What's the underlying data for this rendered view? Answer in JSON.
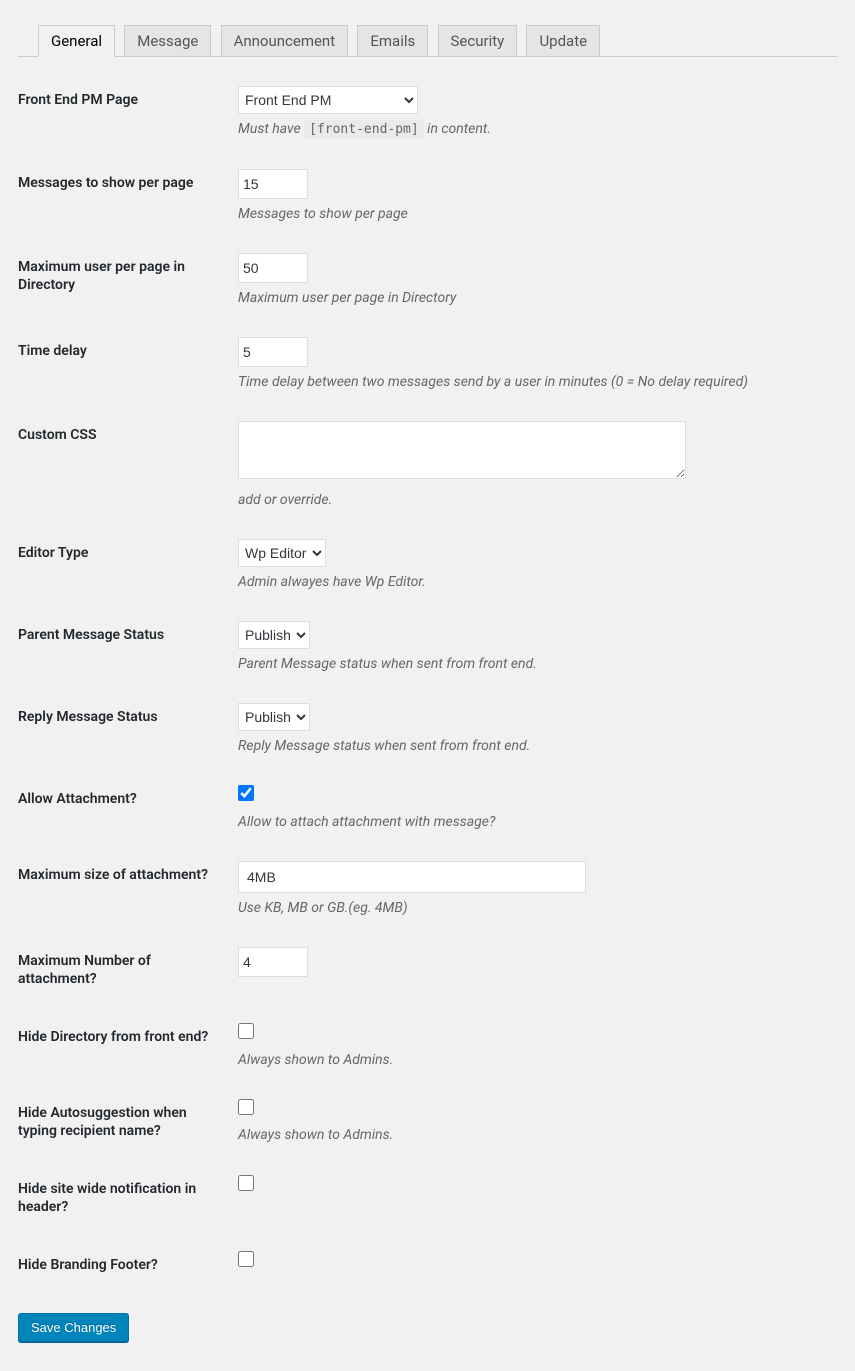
{
  "tabs": {
    "general": "General",
    "message": "Message",
    "announcement": "Announcement",
    "emails": "Emails",
    "security": "Security",
    "update": "Update"
  },
  "fields": {
    "pm_page": {
      "label": "Front End PM Page",
      "value": "Front End PM",
      "desc_prefix": "Must have ",
      "desc_code": "[front-end-pm]",
      "desc_suffix": " in content."
    },
    "msgs_per_page": {
      "label": "Messages to show per page",
      "value": "15",
      "desc": "Messages to show per page"
    },
    "users_per_page": {
      "label": "Maximum user per page in Directory",
      "value": "50",
      "desc": "Maximum user per page in Directory"
    },
    "time_delay": {
      "label": "Time delay",
      "value": "5",
      "desc": "Time delay between two messages send by a user in minutes (0 = No delay required)"
    },
    "custom_css": {
      "label": "Custom CSS",
      "value": "",
      "desc": "add or override."
    },
    "editor_type": {
      "label": "Editor Type",
      "value": "Wp Editor",
      "desc": "Admin alwayes have Wp Editor."
    },
    "parent_status": {
      "label": "Parent Message Status",
      "value": "Publish",
      "desc": "Parent Message status when sent from front end."
    },
    "reply_status": {
      "label": "Reply Message Status",
      "value": "Publish",
      "desc": "Reply Message status when sent from front end."
    },
    "allow_attach": {
      "label": "Allow Attachment?",
      "desc": "Allow to attach attachment with message?"
    },
    "max_size": {
      "label": "Maximum size of attachment?",
      "value": "4MB",
      "desc": "Use KB, MB or GB.(eg. 4MB)"
    },
    "max_num": {
      "label": "Maximum Number of attachment?",
      "value": "4"
    },
    "hide_dir": {
      "label": "Hide Directory from front end?",
      "desc": "Always shown to Admins."
    },
    "hide_autosuggest": {
      "label": "Hide Autosuggestion when typing recipient name?",
      "desc": "Always shown to Admins."
    },
    "hide_notification": {
      "label": "Hide site wide notification in header?"
    },
    "hide_branding": {
      "label": "Hide Branding Footer?"
    }
  },
  "submit": "Save Changes"
}
